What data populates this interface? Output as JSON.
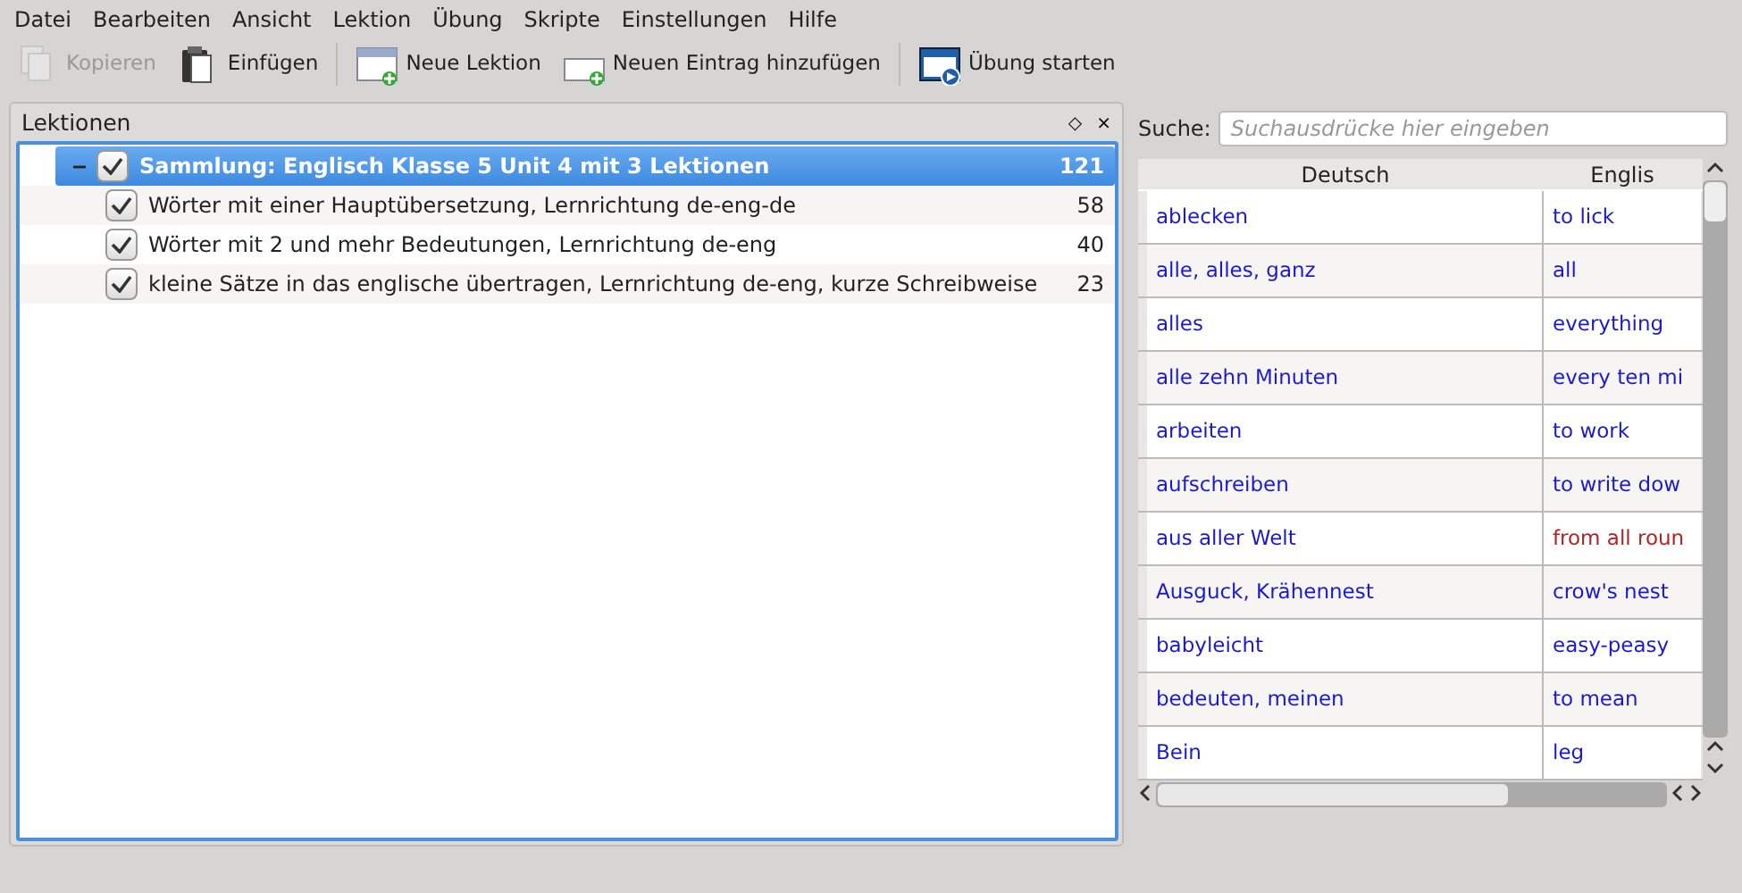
{
  "menu": [
    "Datei",
    "Bearbeiten",
    "Ansicht",
    "Lektion",
    "Übung",
    "Skripte",
    "Einstellungen",
    "Hilfe"
  ],
  "toolbar": [
    {
      "kind": "copy",
      "label": "Kopieren",
      "disabled": true
    },
    {
      "kind": "paste",
      "label": "Einfügen",
      "disabled": false
    },
    {
      "kind": "new-lesson",
      "label": "Neue Lektion",
      "disabled": false,
      "separator_before": true
    },
    {
      "kind": "new-entry",
      "label": "Neuen Eintrag hinzufügen",
      "disabled": false
    },
    {
      "kind": "practice",
      "label": "Übung starten",
      "disabled": false,
      "separator_before": true
    }
  ],
  "lessons_panel": {
    "title": "Lektionen",
    "float_button": "◇",
    "close_button": "×",
    "tree": {
      "label": "Sammlung: Englisch Klasse 5 Unit 4 mit 3 Lektionen",
      "count": "121",
      "checked": true,
      "selected": true,
      "expanded": true,
      "children": [
        {
          "label": "Wörter mit einer Hauptübersetzung, Lernrichtung de-eng-de",
          "count": "58",
          "checked": true,
          "selected": false
        },
        {
          "label": "Wörter mit 2 und mehr Bedeutungen, Lernrichtung de-eng",
          "count": "40",
          "checked": true,
          "selected": false
        },
        {
          "label": "kleine Sätze in das englische übertragen, Lernrichtung de-eng, kurze Schreibweise",
          "count": "23",
          "checked": true,
          "selected": false
        }
      ]
    }
  },
  "search": {
    "label": "Suche:",
    "placeholder": "Suchausdrücke hier eingeben"
  },
  "table": {
    "columns": [
      "Deutsch",
      "Englis"
    ],
    "rows": [
      {
        "cells": [
          "ablecken",
          "to lick"
        ],
        "color": "#1a1acc"
      },
      {
        "cells": [
          "alle, alles, ganz",
          "all"
        ],
        "color": "#1a1acc"
      },
      {
        "cells": [
          "alles",
          "everything"
        ],
        "color": "#1a1acc"
      },
      {
        "cells": [
          "alle zehn Minuten",
          "every ten mi"
        ],
        "color": "#1a1acc"
      },
      {
        "cells": [
          "arbeiten",
          "to work"
        ],
        "color": "#1a1acc"
      },
      {
        "cells": [
          "aufschreiben",
          "to write dow"
        ],
        "color": "#1a1acc"
      },
      {
        "cells": [
          "aus aller Welt",
          "from all roun"
        ],
        "color": "#1a1acc",
        "translation": {
          "color": "#b22222"
        }
      },
      {
        "cells": [
          "Ausguck, Krähennest",
          "crow's nest"
        ],
        "color": "#1a1acc"
      },
      {
        "cells": [
          "babyleicht",
          "easy-peasy"
        ],
        "color": "#1a1acc"
      },
      {
        "cells": [
          "bedeuten, meinen",
          "to mean"
        ],
        "color": "#1a1acc"
      },
      {
        "cells": [
          "Bein",
          "leg"
        ],
        "color": "#1a1acc"
      }
    ]
  }
}
